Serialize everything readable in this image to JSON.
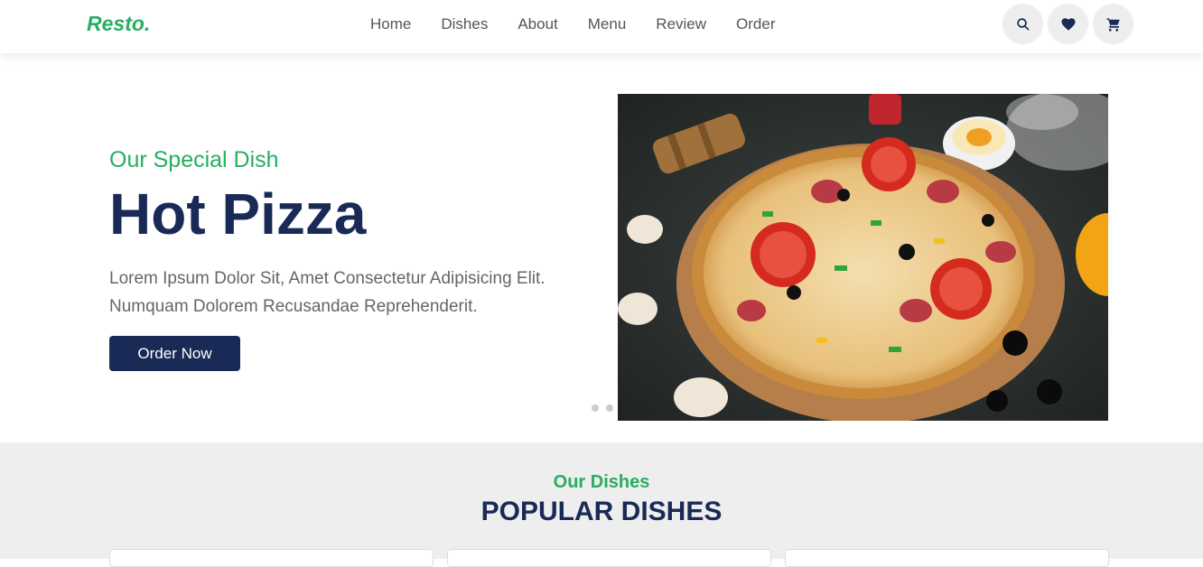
{
  "header": {
    "logo": "Resto.",
    "nav": [
      "Home",
      "Dishes",
      "About",
      "Menu",
      "Review",
      "Order"
    ],
    "icons": [
      "search-icon",
      "heart-icon",
      "cart-icon"
    ]
  },
  "hero": {
    "subtitle": "Our Special Dish",
    "title": "Hot Pizza",
    "description_line1": "Lorem Ipsum Dolor Sit, Amet Consectetur Adipisicing Elit.",
    "description_line2": "Numquam Dolorem Recusandae Reprehenderit.",
    "button": "Order Now",
    "slides": 3,
    "active_slide": 3
  },
  "dishes": {
    "subtitle": "Our Dishes",
    "title": "POPULAR DISHES"
  },
  "colors": {
    "accent": "#27ae60",
    "brand": "#192a56"
  }
}
